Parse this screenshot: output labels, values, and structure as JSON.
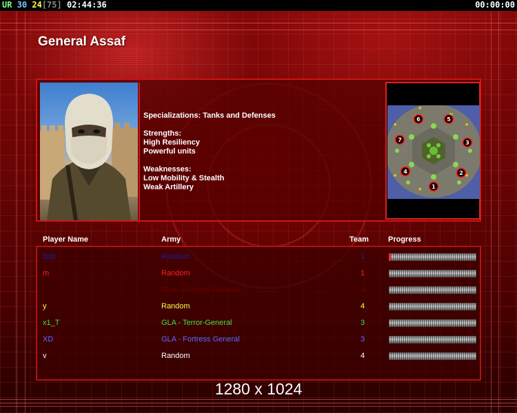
{
  "hud": {
    "label": "UR",
    "value_a": "30",
    "value_b": "24",
    "value_c": "[75]",
    "elapsed": "02:44:36",
    "countdown": "00:00:00"
  },
  "general": {
    "name": "General Assaf",
    "specialization_line": "Specializations: Tanks and Defenses",
    "strengths_heading": "Strengths:",
    "strengths": [
      "High Resiliency",
      "Powerful units"
    ],
    "weaknesses_heading": "Weaknesses:",
    "weaknesses": [
      "Low Mobility & Stealth",
      "Weak Artillery"
    ]
  },
  "map": {
    "start_positions": [
      "1",
      "2",
      "3",
      "4",
      "5",
      "6",
      "7"
    ]
  },
  "table": {
    "headers": {
      "player": "Player Name",
      "army": "Army",
      "team": "Team",
      "progress": "Progress"
    },
    "rows": [
      {
        "name": "bbb",
        "army": "Random",
        "team": "1",
        "color": "#1a1aa8",
        "progress": 0.02
      },
      {
        "name": "m",
        "army": "Random",
        "team": "1",
        "color": "#ff2020",
        "progress": 0
      },
      {
        "name": "",
        "army": "GLA - Fortress General",
        "team": "3",
        "color": "#6a0000",
        "progress": 0
      },
      {
        "name": "y",
        "army": "Random",
        "team": "4",
        "color": "#ffff40",
        "progress": 0
      },
      {
        "name": "x1_T",
        "army": "GLA - Terror-General",
        "team": "3",
        "color": "#40e040",
        "progress": 0
      },
      {
        "name": "XD",
        "army": "GLA - Fortress General",
        "team": "3",
        "color": "#5a6bff",
        "progress": 0
      },
      {
        "name": "v",
        "army": "Random",
        "team": "4",
        "color": "#ffffff",
        "progress": 0
      }
    ]
  },
  "overlay": {
    "resolution": "1280 x 1024"
  }
}
